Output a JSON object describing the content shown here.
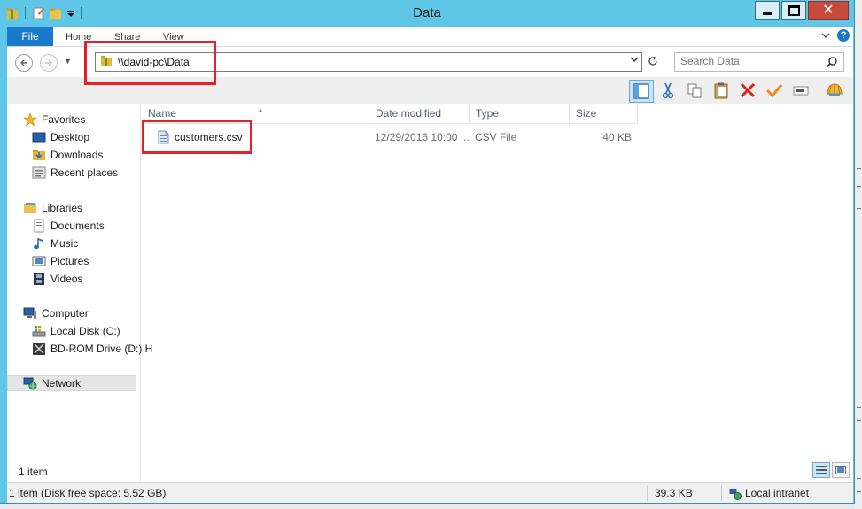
{
  "window": {
    "title": "Data"
  },
  "ribbon": {
    "tabs": [
      {
        "label": "File"
      },
      {
        "label": "Home"
      },
      {
        "label": "Share"
      },
      {
        "label": "View"
      }
    ]
  },
  "address": {
    "path": "\\\\david-pc\\Data"
  },
  "search": {
    "placeholder": "Search Data"
  },
  "navigation": {
    "favorites": {
      "label": "Favorites",
      "items": [
        "Desktop",
        "Downloads",
        "Recent places"
      ]
    },
    "libraries": {
      "label": "Libraries",
      "items": [
        "Documents",
        "Music",
        "Pictures",
        "Videos"
      ]
    },
    "computer": {
      "label": "Computer",
      "items": [
        "Local Disk (C:)",
        "BD-ROM Drive (D:) H"
      ]
    },
    "network": {
      "label": "Network"
    }
  },
  "columns": [
    {
      "label": "Name"
    },
    {
      "label": "Date modified"
    },
    {
      "label": "Type"
    },
    {
      "label": "Size"
    }
  ],
  "files": [
    {
      "name": "customers.csv",
      "date_modified": "12/29/2016 10:00 ...",
      "type": "CSV File",
      "size": "40 KB"
    }
  ],
  "status": {
    "item_count": "1 item",
    "details": "1 item (Disk free space: 5.52 GB)",
    "size": "39.3 KB",
    "zone": "Local intranet"
  },
  "colors": {
    "title_bar": "#5fc6e8",
    "file_tab": "#1979ca",
    "annotation_red": "#e4202b",
    "close_button": "#c74b3c"
  }
}
